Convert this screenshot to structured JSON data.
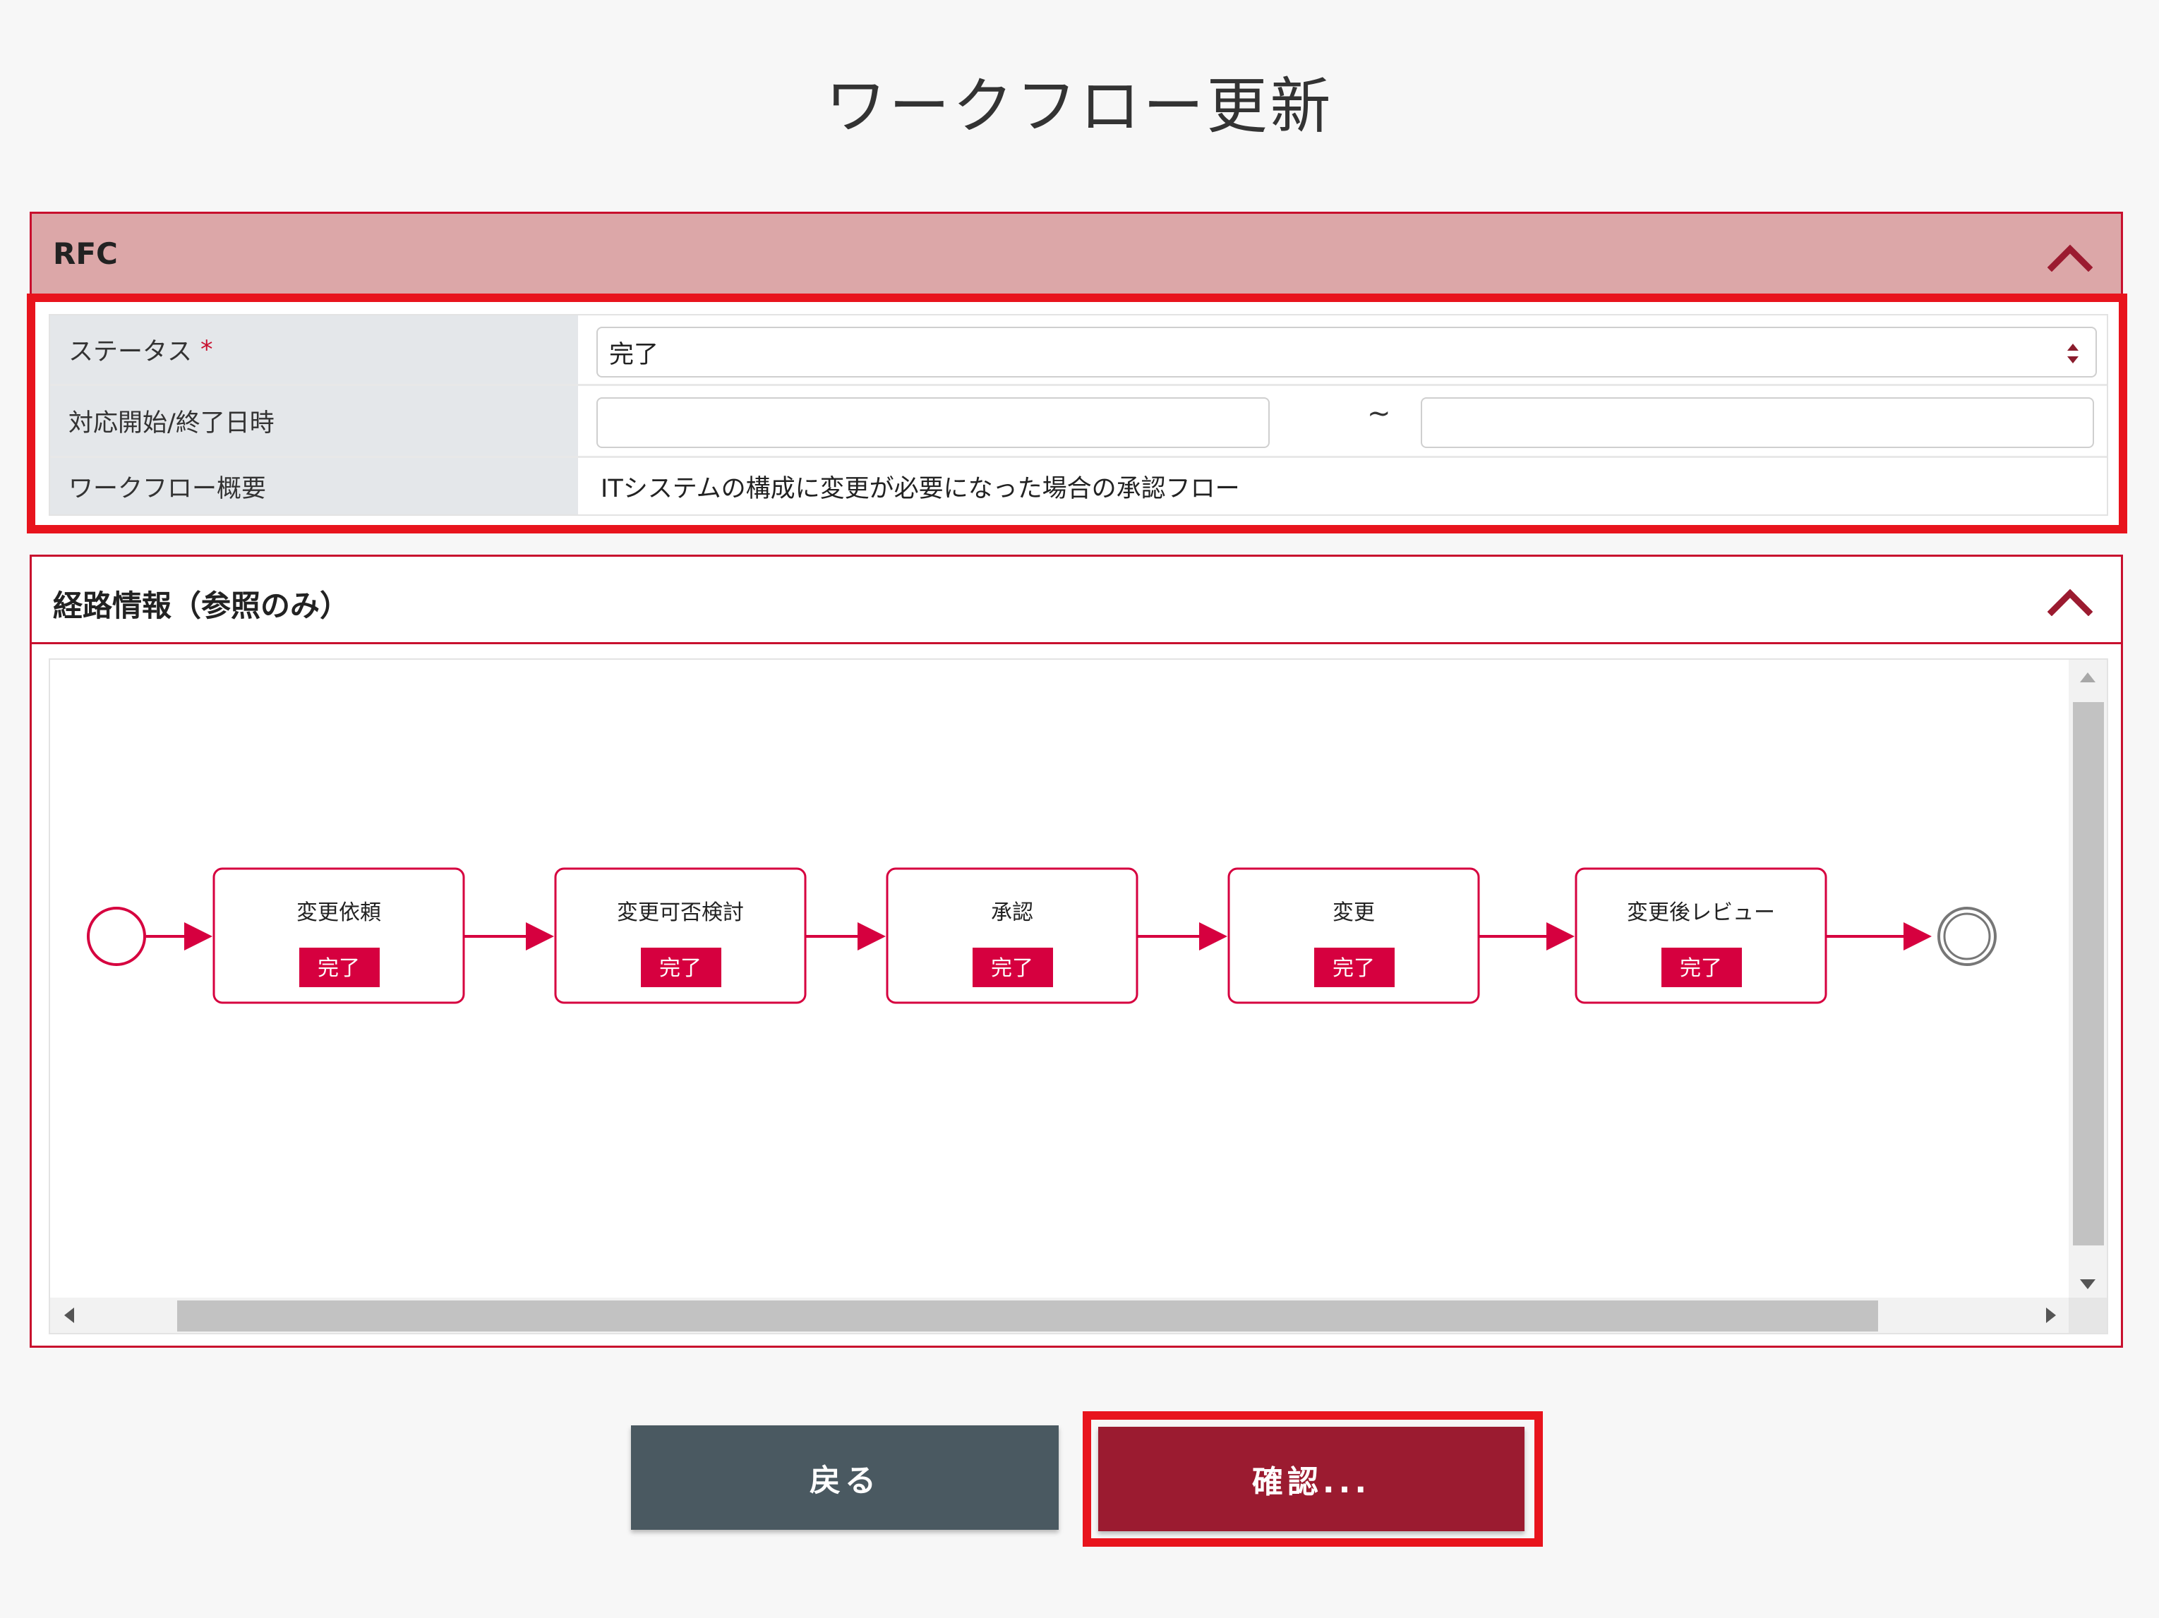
{
  "page": {
    "title": "ワークフロー更新"
  },
  "rfc": {
    "title": "RFC",
    "status_label": "ステータス",
    "required_mark": "*",
    "status_value": "完了",
    "period_label": "対応開始/終了日時",
    "period_start": "",
    "period_separator": "~",
    "period_end": "",
    "summary_label": "ワークフロー概要",
    "summary_value": "ITシステムの構成に変更が必要になった場合の承認フロー"
  },
  "route": {
    "title": "経路情報（参照のみ）",
    "steps": [
      {
        "name": "変更依頼",
        "status": "完了"
      },
      {
        "name": "変更可否検討",
        "status": "完了"
      },
      {
        "name": "承認",
        "status": "完了"
      },
      {
        "name": "変更",
        "status": "完了"
      },
      {
        "name": "変更後レビュー",
        "status": "完了"
      }
    ]
  },
  "buttons": {
    "back_label": "戻る",
    "confirm_label": "確認..."
  },
  "colors": {
    "accent": "#c8102e",
    "header_bg": "#dca7a8",
    "status_badge": "#d6003f",
    "back_button": "#4a5961",
    "confirm_button": "#9b1b30",
    "highlight": "#e8141d"
  },
  "icons": {
    "collapse": "chevron-up-icon",
    "select": "select-arrows-icon",
    "start": "start-event-icon",
    "end": "end-event-icon"
  }
}
